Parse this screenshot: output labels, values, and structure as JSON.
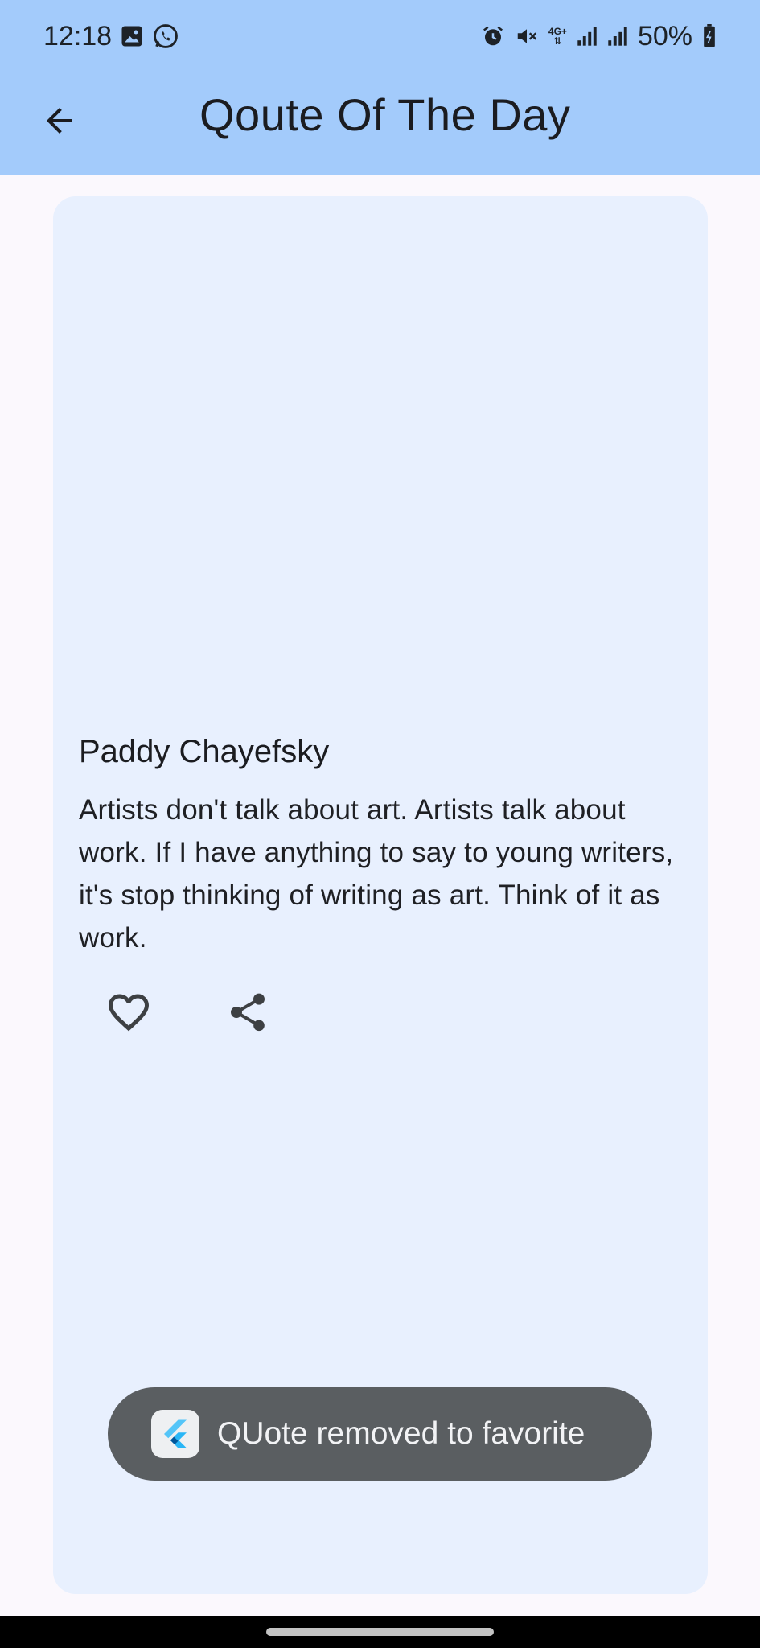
{
  "status_bar": {
    "time": "12:18",
    "left_icons": [
      "gallery-icon",
      "whatsapp-icon"
    ],
    "right_icons": [
      "alarm-icon",
      "mute-icon",
      "4g-data-icon",
      "signal-icon",
      "signal-icon"
    ],
    "network_label": "4G+",
    "battery": "50%"
  },
  "app_bar": {
    "title": "Qoute Of The Day",
    "back_icon": "arrow-back-icon",
    "background": "#a3cbfb"
  },
  "quote_card": {
    "author": "Paddy Chayefsky",
    "text": "Artists don't talk about art. Artists talk about work. If I have anything to say to young writers, it's stop thinking of writing as art. Think of it as work.",
    "background": "#e8f0fe",
    "actions": [
      {
        "icon": "heart-outline-icon",
        "label": "favorite"
      },
      {
        "icon": "share-icon",
        "label": "share"
      }
    ]
  },
  "toast": {
    "text": "QUote removed to favorite",
    "icon": "flutter-logo-icon",
    "background": "#5a5e61"
  }
}
